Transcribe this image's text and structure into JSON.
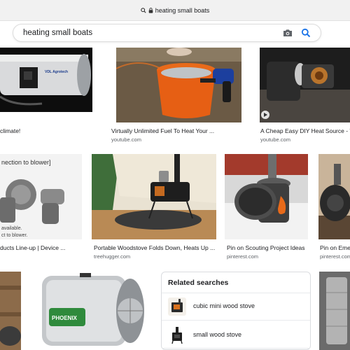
{
  "browser": {
    "url_text": "heating small boats"
  },
  "search": {
    "query": "heating small boats"
  },
  "results_row1": [
    {
      "caption": "climate!",
      "source": ""
    },
    {
      "caption": "Virtually Unlimited Fuel To Heat Your ...",
      "source": "youtube.com"
    },
    {
      "caption": "A Cheap Easy DIY Heat Source - Y",
      "source": "youtube.com"
    }
  ],
  "results_row2": [
    {
      "caption": "ducts Line-up | Device ...",
      "source": ""
    },
    {
      "caption": "Portable Woodstove Folds Down, Heats Up ...",
      "source": "treehugger.com"
    },
    {
      "caption": "Pin on Scouting Project Ideas",
      "source": "pinterest.com"
    },
    {
      "caption": "Pin on Eme",
      "source": "pinterest.com"
    }
  ],
  "image_text": {
    "blower_banner_top": "nection to blower]",
    "blower_note_1": "available.",
    "blower_note_2": "ct to blower.",
    "heater1_brand": "VDL Agrotech",
    "heater2_brand": "PHOENIX"
  },
  "related": {
    "title": "Related searches",
    "items": [
      {
        "label": "cubic mini wood stove"
      },
      {
        "label": "small wood stove"
      }
    ]
  }
}
